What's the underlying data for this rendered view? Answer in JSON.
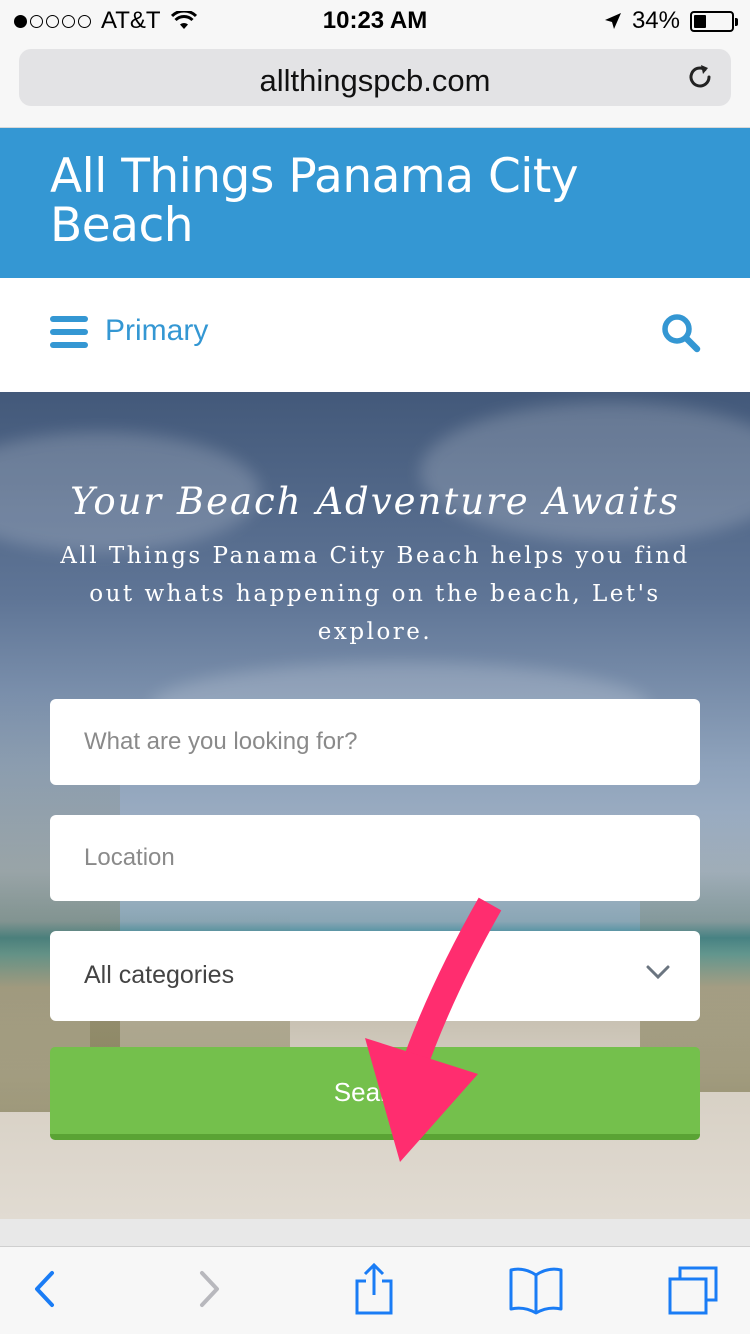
{
  "status_bar": {
    "carrier": "AT&T",
    "time": "10:23 AM",
    "battery": "34%",
    "battery_level": 0.34,
    "signal_bars": 1
  },
  "browser": {
    "url": "allthingspcb.com"
  },
  "site": {
    "title": "All Things Panama City Beach"
  },
  "nav": {
    "label": "Primary"
  },
  "hero": {
    "heading": "Your Beach Adventure Awaits",
    "text": "All Things Panama City Beach helps you find out whats happening on the beach, Let's explore."
  },
  "search_form": {
    "keyword_placeholder": "What are you looking for?",
    "location_placeholder": "Location",
    "category_value": "All categories",
    "button_label": "Search"
  },
  "colors": {
    "header_blue": "#3497d3",
    "button_green": "#74c04c",
    "arrow_pink": "#ff2d6f",
    "toolbar_blue": "#1a7cf5"
  },
  "icons": [
    "wifi-icon",
    "location-arrow-icon",
    "reload-icon",
    "hamburger-icon",
    "search-icon",
    "chevron-down-icon",
    "back-icon",
    "forward-icon",
    "share-icon",
    "bookmarks-icon",
    "tabs-icon"
  ]
}
